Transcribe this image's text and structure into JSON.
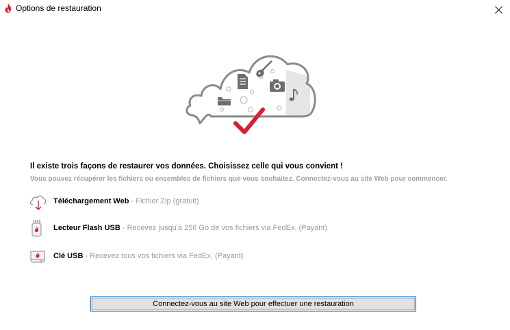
{
  "window": {
    "title": "Options de restauration",
    "app_icon": "flame-logo-icon",
    "close_icon": "close-icon"
  },
  "hero": {
    "icons": [
      "cloud-icon",
      "document-icon",
      "guitar-icon",
      "camera-icon",
      "music-note-icon",
      "folder-icon",
      "checkmark-icon"
    ]
  },
  "intro": {
    "headline": "Il existe trois façons de restaurer vos données.  Choisissez celle qui vous convient !",
    "subline": "Vous pouvez récupérer les fichiers ou ensembles de fichiers que vous souhaitez.  Connectez-vous au site Web pour commencer."
  },
  "options": [
    {
      "title": "Téléchargement Web",
      "separator": " - ",
      "description": "Fichier Zip (gratuit)",
      "icon": "cloud-download-icon"
    },
    {
      "title": "Lecteur Flash USB",
      "separator": " - ",
      "description": "Recevez jusqu'à 256 Go de vos fichiers via FedEx.  (Payant)",
      "icon": "usb-flash-drive-icon"
    },
    {
      "title": "Clé USB",
      "separator": " - ",
      "description": "Recevez tous vos fichiers via FedEx.  (Payant)",
      "icon": "hard-drive-icon"
    }
  ],
  "action": {
    "label": "Connectez-vous au site Web pour effectuer une restauration"
  },
  "colors": {
    "accent_red": "#d71f35",
    "button_border": "#0078d7",
    "button_bg": "#e1e1e1",
    "muted_text": "#9a9a9a",
    "cloud_outline": "#8a8a8a"
  }
}
